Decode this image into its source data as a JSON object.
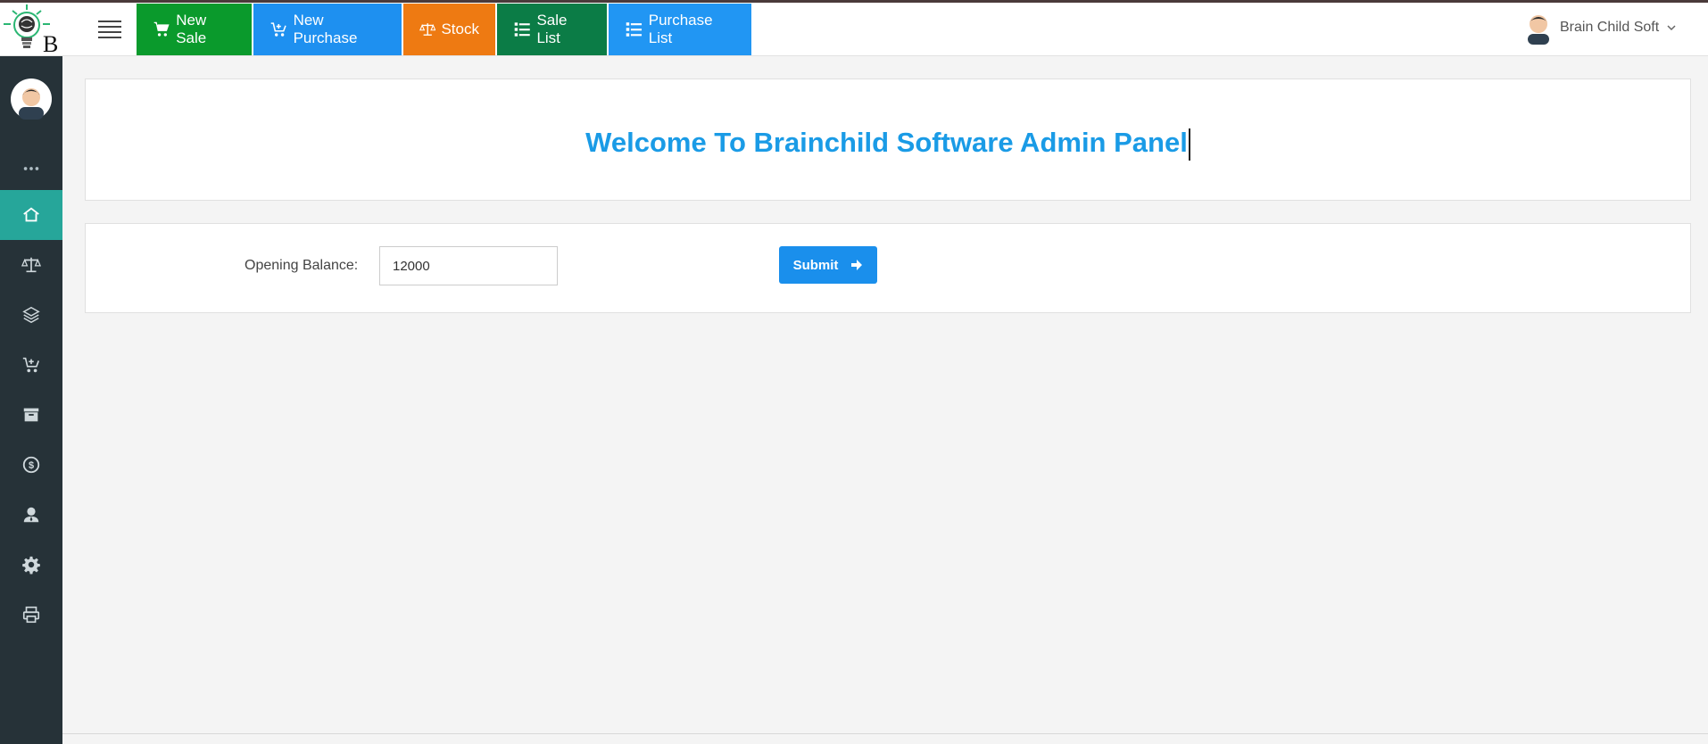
{
  "header": {
    "nav": [
      {
        "label": "New Sale",
        "icon": "cart-icon",
        "color": "#0a9a2c"
      },
      {
        "label": "New Purchase",
        "icon": "cart-plus-icon",
        "color": "#1e90f0"
      },
      {
        "label": "Stock",
        "icon": "balance-scale-icon",
        "color": "#ee7a12"
      },
      {
        "label": "Sale List",
        "icon": "list-icon",
        "color": "#0b7c46"
      },
      {
        "label": "Purchase List",
        "icon": "list-icon",
        "color": "#2196f3"
      }
    ],
    "user_name": "Brain Child Soft",
    "logo_letter": "B"
  },
  "sidebar": {
    "items": [
      {
        "icon": "more-dots-icon"
      },
      {
        "icon": "home-icon",
        "active": true
      },
      {
        "icon": "balance-scale-icon"
      },
      {
        "icon": "layers-icon"
      },
      {
        "icon": "cart-plus-icon"
      },
      {
        "icon": "archive-icon"
      },
      {
        "icon": "dollar-circle-icon"
      },
      {
        "icon": "user-tie-icon"
      },
      {
        "icon": "gear-icon"
      },
      {
        "icon": "printer-icon"
      }
    ]
  },
  "main": {
    "welcome_title": "Welcome To Brainchild Software Admin Panel",
    "opening_balance_label": "Opening Balance:",
    "opening_balance_value": "12000",
    "submit_label": "Submit"
  },
  "colors": {
    "accent": "#1a9be6",
    "sidebar_bg": "#263238",
    "sidebar_active": "#26a69a"
  }
}
